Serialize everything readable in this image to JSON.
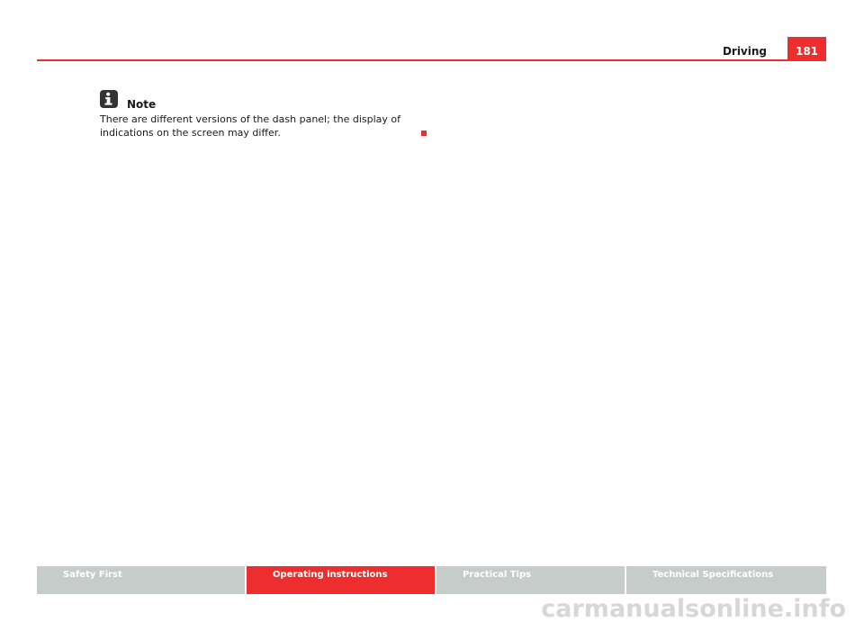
{
  "header": {
    "section_title": "Driving",
    "page_number": "181"
  },
  "note": {
    "icon": "info-icon",
    "heading": "Note",
    "body": "There are different versions of the dash panel; the display of indications on the screen may differ."
  },
  "footer_nav": {
    "tabs": [
      {
        "label": "Safety First",
        "active": false
      },
      {
        "label": "Operating instructions",
        "active": true
      },
      {
        "label": "Practical Tips",
        "active": false
      },
      {
        "label": "Technical Specifications",
        "active": false
      }
    ]
  },
  "watermark": "carmanualsonline.info",
  "colors": {
    "accent": "#ee2e2e",
    "tab_inactive": "#c5ccc9",
    "text": "#1a1a1a"
  }
}
